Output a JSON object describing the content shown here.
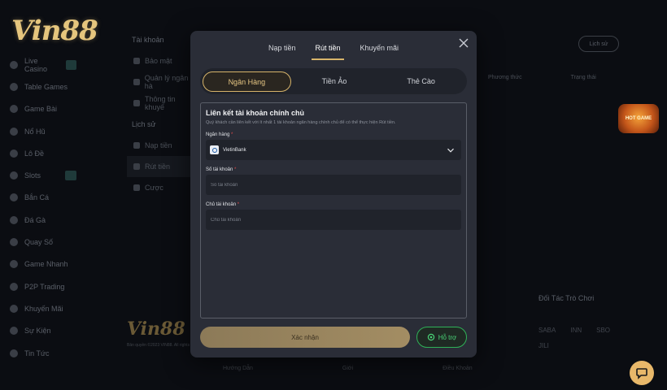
{
  "brand": {
    "logo": "Vin88",
    "accent": "#d7b46a",
    "support_green": "#2fb157"
  },
  "sidebar": {
    "items": [
      {
        "label": "Live Casino",
        "icon": "casino-chip-icon"
      },
      {
        "label": "Table Games",
        "icon": "crossed-cards-icon"
      },
      {
        "label": "Game Bài",
        "icon": "cards-icon"
      },
      {
        "label": "Nổ Hũ",
        "icon": "jar-icon"
      },
      {
        "label": "Lô Đề",
        "icon": "lottery-ball-icon"
      },
      {
        "label": "Slots",
        "icon": "slot-machine-icon"
      },
      {
        "label": "Bắn Cá",
        "icon": "fish-icon"
      },
      {
        "label": "Đá Gà",
        "icon": "rooster-icon"
      },
      {
        "label": "Quay Số",
        "icon": "dice-icon"
      },
      {
        "label": "Game Nhanh",
        "icon": "controller-icon"
      },
      {
        "label": "P2P Trading",
        "icon": "exchange-icon"
      },
      {
        "label": "Khuyến Mãi",
        "icon": "gift-icon"
      },
      {
        "label": "Sự Kiện",
        "icon": "trophy-icon"
      },
      {
        "label": "Tin Tức",
        "icon": "news-icon"
      }
    ]
  },
  "account_panel": {
    "heading_account": "Tài khoản",
    "item_security": "Bảo mật",
    "item_bank": "Quản lý ngân hà",
    "item_info": "Thông tin khuyế",
    "heading_history": "Lịch sử",
    "item_deposit": "Nạp tiền",
    "item_withdraw": "Rút tiền",
    "item_bet": "Cược"
  },
  "background": {
    "logout": "Lịch sử",
    "col_a": "Phương thức",
    "col_b": "Trạng thái",
    "partners_title": "Đối Tác Trò Chơi",
    "partner_logos": [
      "SABA",
      "INN",
      "SBO",
      "JILI"
    ],
    "footer_logo": "Vin88",
    "footer_copy": "Bản quyền ©2023 VIN88. All rights reserved",
    "footer_links": [
      "Hướng Dẫn",
      "Giới",
      "Điều Khoản"
    ],
    "promo_label": "HOT GAME"
  },
  "modal": {
    "tabs": [
      "Nạp tiền",
      "Rút tiền",
      "Khuyến mãi"
    ],
    "sub_tabs": [
      "Ngân Hàng",
      "Tiền Ảo",
      "Thẻ Cào"
    ],
    "form": {
      "title": "Liên kết tài khoản chính chủ",
      "description": "Quý khách cần liên kết với ít nhất 1 tài khoản ngân hàng chính chủ để có thể thực hiện Rút tiền.",
      "bank_label": "Ngân hàng",
      "bank_value": "VietinBank",
      "account_number_label": "Số tài khoản",
      "account_number_placeholder": "Số tài khoản",
      "account_holder_label": "Chủ tài khoản",
      "account_holder_placeholder": "Chủ tài khoản",
      "required_mark": "*"
    },
    "confirm_button": "Xác nhận",
    "support_button": "Hỗ trợ"
  }
}
